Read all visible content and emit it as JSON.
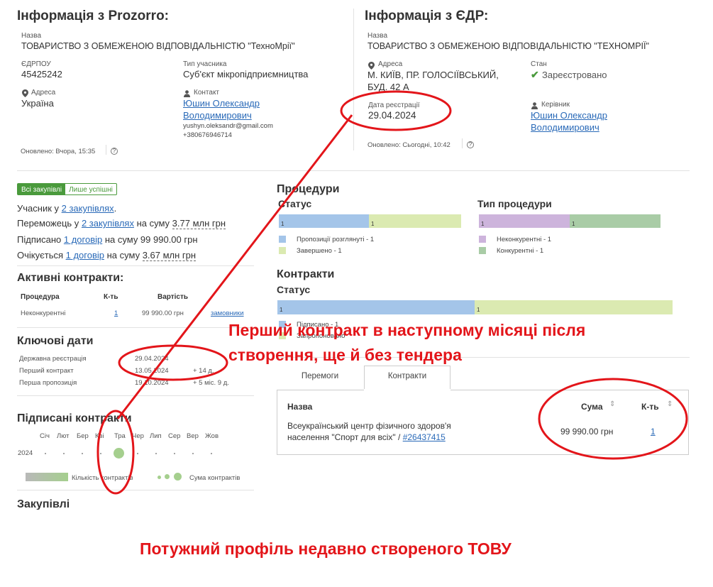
{
  "prozorro": {
    "title": "Інформація з Prozorro:",
    "name_label": "Назва",
    "name_value": "ТОВАРИСТВО З ОБМЕЖЕНОЮ ВІДПОВІДАЛЬНІСТЮ \"ТехноМрії\"",
    "edrpou_label": "ЄДРПОУ",
    "edrpou_value": "45425242",
    "type_label": "Тип учасника",
    "type_value": "Суб'єкт мікропідприємництва",
    "address_label": "Адреса",
    "address_value": "Україна",
    "contact_label": "Контакт",
    "contact_name_1": "Юшин Олександр",
    "contact_name_2": "Володимирович",
    "contact_email": "yushyn.oleksandr@gmail.com",
    "contact_phone": "+380676946714",
    "updated": "Оновлено: Вчора, 15:35"
  },
  "edr": {
    "title": "Інформація з ЄДР:",
    "name_label": "Назва",
    "name_value": "ТОВАРИСТВО З ОБМЕЖЕНОЮ ВІДПОВІДАЛЬНІСТЮ \"ТЕХНОМРІЇ\"",
    "address_label": "Адреса",
    "address_value_1": "М. КИЇВ, ПР. ГОЛОСІЇВСЬКИЙ,",
    "address_value_2": "БУД. 42 А",
    "state_label": "Стан",
    "state_value": "Зареєстровано",
    "regdate_label": "Дата реєстрації",
    "regdate_value": "29.04.2024",
    "head_label": "Керівник",
    "head_name_1": "Юшин Олександр",
    "head_name_2": "Володимирович",
    "updated": "Оновлено: Сьогодні, 10:42"
  },
  "filter": {
    "all": "Всі закупівлі",
    "success": "Лише успішні"
  },
  "summary": {
    "line1_pre": "Учасник у ",
    "line1_link": "2 закупівлях",
    "line1_post": ".",
    "line2_pre": "Переможець у ",
    "line2_link": "2 закупівлях",
    "line2_mid": " на суму ",
    "line2_sum": "3.77 млн грн",
    "line3_pre": "Підписано ",
    "line3_link": "1 договір",
    "line3_post": " на суму 99 990.00 грн",
    "line4_pre": "Очікується ",
    "line4_link": "1 договір",
    "line4_mid": " на суму ",
    "line4_sum": "3.67 млн грн"
  },
  "active_contracts": {
    "title": "Активні контракти:",
    "col_procedure": "Процедура",
    "col_count": "К-ть",
    "col_value": "Вартість",
    "row_procedure": "Неконкурентні",
    "row_count": "1",
    "row_value": "99 990.00 грн",
    "row_link": "замовники"
  },
  "key_dates": {
    "title": "Ключові дати",
    "items": [
      {
        "label": "Державна реєстрація",
        "value": "29.04.2024",
        "extra": ""
      },
      {
        "label": "Перший контракт",
        "value": "13.05.2024",
        "extra": "+ 14 д."
      },
      {
        "label": "Перша пропозиція",
        "value": "19.10.2024",
        "extra": "+ 5 міс. 9 д."
      }
    ]
  },
  "signed_contracts": {
    "title": "Підписані контракти",
    "months": [
      "Січ",
      "Лют",
      "Бер",
      "Кві",
      "Тра",
      "Чер",
      "Лип",
      "Сер",
      "Вер",
      "Жов"
    ],
    "year": "2024",
    "legend_count": "Кількість контрактів",
    "legend_sum": "Сума контрактів",
    "bubble_color": "#a5cf8e"
  },
  "purchases_title": "Закупівлі",
  "procedures": {
    "title": "Процедури",
    "status_title": "Статус",
    "status_bar": [
      {
        "label": "1",
        "color": "#a4c5e9",
        "share": 0.5
      },
      {
        "label": "1",
        "color": "#dbeab1",
        "share": 0.5
      }
    ],
    "status_legend": [
      {
        "label": "Пропозиції розглянуті - 1",
        "color": "#a4c5e9"
      },
      {
        "label": "Завершено - 1",
        "color": "#dbeab1"
      }
    ],
    "type_title": "Тип процедури",
    "type_bar": [
      {
        "label": "1",
        "color": "#cdb4dc",
        "share": 0.5
      },
      {
        "label": "1",
        "color": "#a9cca6",
        "share": 0.5
      }
    ],
    "type_legend": [
      {
        "label": "Неконкурентні - 1",
        "color": "#cdb4dc"
      },
      {
        "label": "Конкурентні - 1",
        "color": "#a9cca6"
      }
    ]
  },
  "contracts": {
    "title": "Контракти",
    "status_title": "Статус",
    "status_bar": [
      {
        "label": "1",
        "color": "#a4c5e9",
        "share": 0.5
      },
      {
        "label": "1",
        "color": "#dbeab1",
        "share": 0.5
      }
    ],
    "legend_1": "Підписано - 1",
    "legend_2": "Запропоновано"
  },
  "tabs": {
    "wins": "Перемоги",
    "contracts": "Контракти"
  },
  "contracts_table": {
    "col_name": "Назва",
    "col_sum": "Сума",
    "col_count": "К-ть",
    "row_name_1": "Всеукраїнський центр фізичного здоров'я",
    "row_name_2": "населення \"Спорт для всіх\" / ",
    "row_link": "#26437415",
    "row_sum": "99 990.00 грн",
    "row_count": "1"
  },
  "annotations": {
    "middle_1": "Перший контракт в наступному місяці після",
    "middle_2": "створення, ще й без тендера",
    "bottom": "Потужний профіль недавно створеного ТОВУ",
    "color": "#e3151a"
  }
}
